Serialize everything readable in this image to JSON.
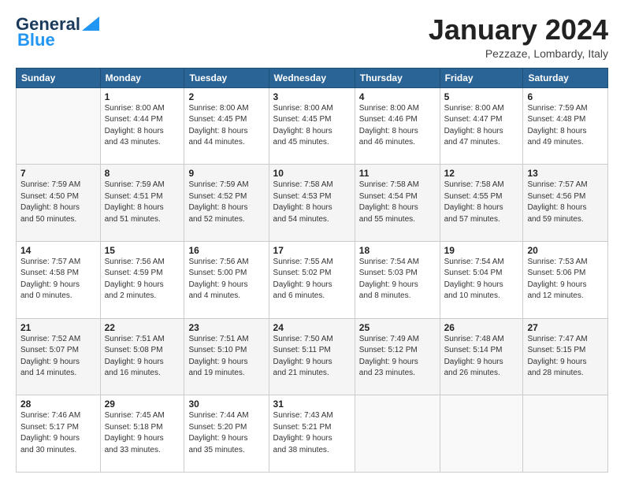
{
  "logo": {
    "line1": "General",
    "line2": "Blue"
  },
  "header": {
    "month": "January 2024",
    "location": "Pezzaze, Lombardy, Italy"
  },
  "weekdays": [
    "Sunday",
    "Monday",
    "Tuesday",
    "Wednesday",
    "Thursday",
    "Friday",
    "Saturday"
  ],
  "weeks": [
    [
      {
        "day": "",
        "info": ""
      },
      {
        "day": "1",
        "info": "Sunrise: 8:00 AM\nSunset: 4:44 PM\nDaylight: 8 hours\nand 43 minutes."
      },
      {
        "day": "2",
        "info": "Sunrise: 8:00 AM\nSunset: 4:45 PM\nDaylight: 8 hours\nand 44 minutes."
      },
      {
        "day": "3",
        "info": "Sunrise: 8:00 AM\nSunset: 4:45 PM\nDaylight: 8 hours\nand 45 minutes."
      },
      {
        "day": "4",
        "info": "Sunrise: 8:00 AM\nSunset: 4:46 PM\nDaylight: 8 hours\nand 46 minutes."
      },
      {
        "day": "5",
        "info": "Sunrise: 8:00 AM\nSunset: 4:47 PM\nDaylight: 8 hours\nand 47 minutes."
      },
      {
        "day": "6",
        "info": "Sunrise: 7:59 AM\nSunset: 4:48 PM\nDaylight: 8 hours\nand 49 minutes."
      }
    ],
    [
      {
        "day": "7",
        "info": "Sunrise: 7:59 AM\nSunset: 4:50 PM\nDaylight: 8 hours\nand 50 minutes."
      },
      {
        "day": "8",
        "info": "Sunrise: 7:59 AM\nSunset: 4:51 PM\nDaylight: 8 hours\nand 51 minutes."
      },
      {
        "day": "9",
        "info": "Sunrise: 7:59 AM\nSunset: 4:52 PM\nDaylight: 8 hours\nand 52 minutes."
      },
      {
        "day": "10",
        "info": "Sunrise: 7:58 AM\nSunset: 4:53 PM\nDaylight: 8 hours\nand 54 minutes."
      },
      {
        "day": "11",
        "info": "Sunrise: 7:58 AM\nSunset: 4:54 PM\nDaylight: 8 hours\nand 55 minutes."
      },
      {
        "day": "12",
        "info": "Sunrise: 7:58 AM\nSunset: 4:55 PM\nDaylight: 8 hours\nand 57 minutes."
      },
      {
        "day": "13",
        "info": "Sunrise: 7:57 AM\nSunset: 4:56 PM\nDaylight: 8 hours\nand 59 minutes."
      }
    ],
    [
      {
        "day": "14",
        "info": "Sunrise: 7:57 AM\nSunset: 4:58 PM\nDaylight: 9 hours\nand 0 minutes."
      },
      {
        "day": "15",
        "info": "Sunrise: 7:56 AM\nSunset: 4:59 PM\nDaylight: 9 hours\nand 2 minutes."
      },
      {
        "day": "16",
        "info": "Sunrise: 7:56 AM\nSunset: 5:00 PM\nDaylight: 9 hours\nand 4 minutes."
      },
      {
        "day": "17",
        "info": "Sunrise: 7:55 AM\nSunset: 5:02 PM\nDaylight: 9 hours\nand 6 minutes."
      },
      {
        "day": "18",
        "info": "Sunrise: 7:54 AM\nSunset: 5:03 PM\nDaylight: 9 hours\nand 8 minutes."
      },
      {
        "day": "19",
        "info": "Sunrise: 7:54 AM\nSunset: 5:04 PM\nDaylight: 9 hours\nand 10 minutes."
      },
      {
        "day": "20",
        "info": "Sunrise: 7:53 AM\nSunset: 5:06 PM\nDaylight: 9 hours\nand 12 minutes."
      }
    ],
    [
      {
        "day": "21",
        "info": "Sunrise: 7:52 AM\nSunset: 5:07 PM\nDaylight: 9 hours\nand 14 minutes."
      },
      {
        "day": "22",
        "info": "Sunrise: 7:51 AM\nSunset: 5:08 PM\nDaylight: 9 hours\nand 16 minutes."
      },
      {
        "day": "23",
        "info": "Sunrise: 7:51 AM\nSunset: 5:10 PM\nDaylight: 9 hours\nand 19 minutes."
      },
      {
        "day": "24",
        "info": "Sunrise: 7:50 AM\nSunset: 5:11 PM\nDaylight: 9 hours\nand 21 minutes."
      },
      {
        "day": "25",
        "info": "Sunrise: 7:49 AM\nSunset: 5:12 PM\nDaylight: 9 hours\nand 23 minutes."
      },
      {
        "day": "26",
        "info": "Sunrise: 7:48 AM\nSunset: 5:14 PM\nDaylight: 9 hours\nand 26 minutes."
      },
      {
        "day": "27",
        "info": "Sunrise: 7:47 AM\nSunset: 5:15 PM\nDaylight: 9 hours\nand 28 minutes."
      }
    ],
    [
      {
        "day": "28",
        "info": "Sunrise: 7:46 AM\nSunset: 5:17 PM\nDaylight: 9 hours\nand 30 minutes."
      },
      {
        "day": "29",
        "info": "Sunrise: 7:45 AM\nSunset: 5:18 PM\nDaylight: 9 hours\nand 33 minutes."
      },
      {
        "day": "30",
        "info": "Sunrise: 7:44 AM\nSunset: 5:20 PM\nDaylight: 9 hours\nand 35 minutes."
      },
      {
        "day": "31",
        "info": "Sunrise: 7:43 AM\nSunset: 5:21 PM\nDaylight: 9 hours\nand 38 minutes."
      },
      {
        "day": "",
        "info": ""
      },
      {
        "day": "",
        "info": ""
      },
      {
        "day": "",
        "info": ""
      }
    ]
  ]
}
